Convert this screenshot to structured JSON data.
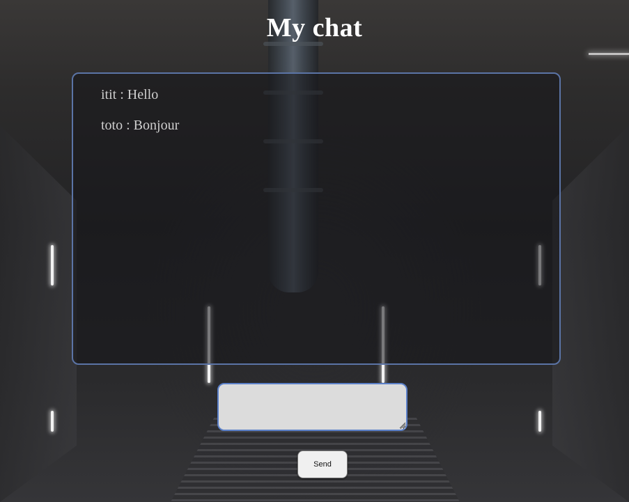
{
  "page": {
    "title": "My chat"
  },
  "chat": {
    "messages": [
      {
        "text": "itit : Hello"
      },
      {
        "text": "toto : Bonjour"
      }
    ]
  },
  "composer": {
    "input_value": "",
    "send_label": "Send"
  },
  "colors": {
    "title": "#ffffff",
    "chat_border": "#5b74a6",
    "input_border": "#5b80c9",
    "message_text": "#cfcfcf"
  }
}
